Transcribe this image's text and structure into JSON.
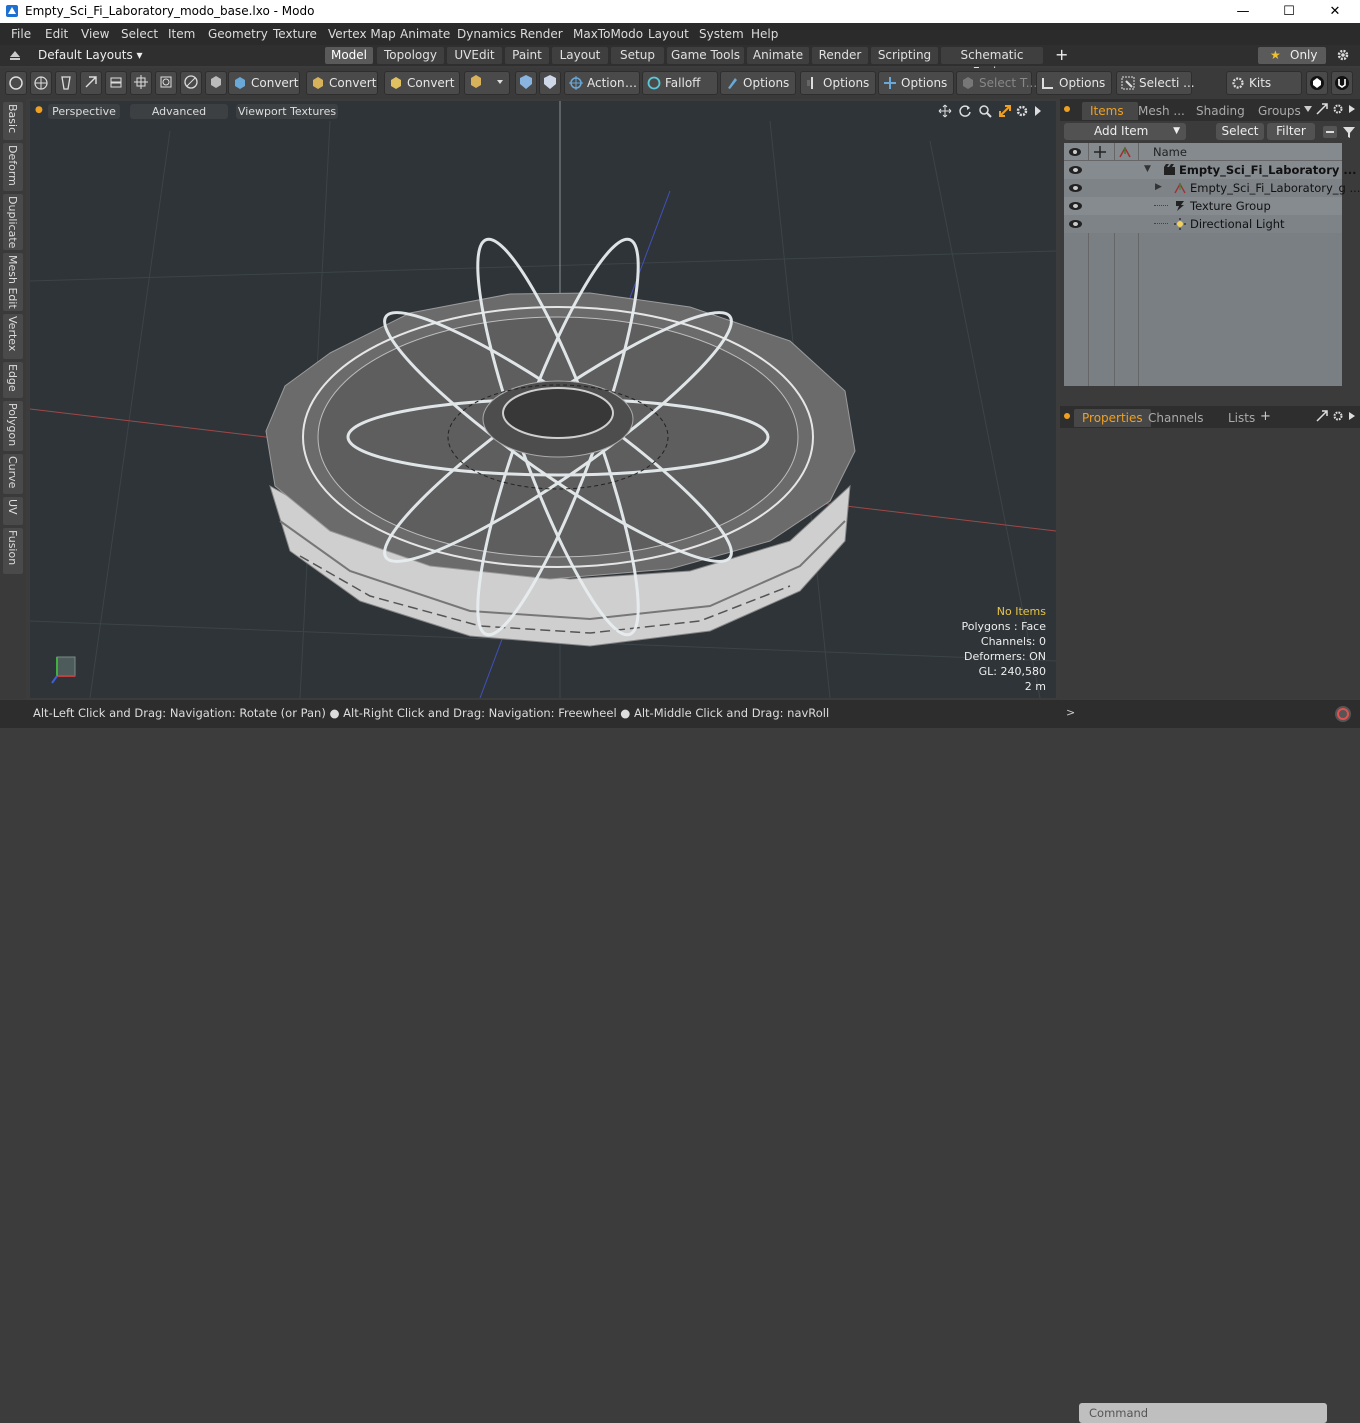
{
  "title": "Empty_Sci_Fi_Laboratory_modo_base.lxo - Modo",
  "window_buttons": {
    "minimize": "—",
    "maximize": "☐",
    "close": "✕"
  },
  "menu": [
    "File",
    "Edit",
    "View",
    "Select",
    "Item",
    "Geometry",
    "Texture",
    "Vertex Map",
    "Animate",
    "Dynamics",
    "Render",
    "MaxToModo",
    "Layout",
    "System",
    "Help"
  ],
  "layouts_label": "Default Layouts ▾",
  "tabs": [
    "Model",
    "Topology",
    "UVEdit",
    "Paint",
    "Layout",
    "Setup",
    "Game Tools",
    "Animate",
    "Render",
    "Scripting",
    "Schematic Fusion"
  ],
  "active_tab": "Model",
  "add_tab": "+",
  "only_label": "Only",
  "toolbar": {
    "convert1": "Convert",
    "convert2": "Convert",
    "convert3": "Convert",
    "action": "Action",
    "falloff": "Falloff",
    "options1": "Options",
    "options2": "Options",
    "options3": "Options",
    "select_t": "Select T...",
    "options4": "Options",
    "selecti": "Selecti ...",
    "kits": "Kits"
  },
  "left_tabs": [
    "Basic",
    "Deform",
    "Duplicate",
    "Mesh Edit",
    "Vertex",
    "Edge",
    "Polygon",
    "Curve",
    "UV",
    "Fusion"
  ],
  "viewport": {
    "perspective": "Perspective",
    "advanced": "Advanced",
    "textures": "Viewport Textures"
  },
  "hud": {
    "no_items": "No Items",
    "polygons": "Polygons : Face",
    "channels": "Channels: 0",
    "deformers": "Deformers: ON",
    "gl": "GL: 240,580",
    "scale": "2 m"
  },
  "status": "Alt-Left Click and Drag: Navigation: Rotate (or Pan) ● Alt-Right Click and Drag: Navigation: Freewheel ● Alt-Middle Click and Drag: navRoll",
  "command_placeholder": "Command",
  "right_tabs": [
    "Items",
    "Mesh ...",
    "Shading",
    "Groups"
  ],
  "add_item": "Add Item",
  "select_btn": "Select",
  "filter_btn": "Filter",
  "name_header": "Name",
  "items": [
    {
      "label": "Empty_Sci_Fi_Laboratory ...",
      "bold": true
    },
    {
      "label": "Empty_Sci_Fi_Laboratory_g ...",
      "bold": false
    },
    {
      "label": "Texture Group",
      "bold": false
    },
    {
      "label": "Directional Light",
      "bold": false
    }
  ],
  "prop_tabs": [
    "Properties",
    "Channels",
    "Lists"
  ],
  "prop_add": "+"
}
